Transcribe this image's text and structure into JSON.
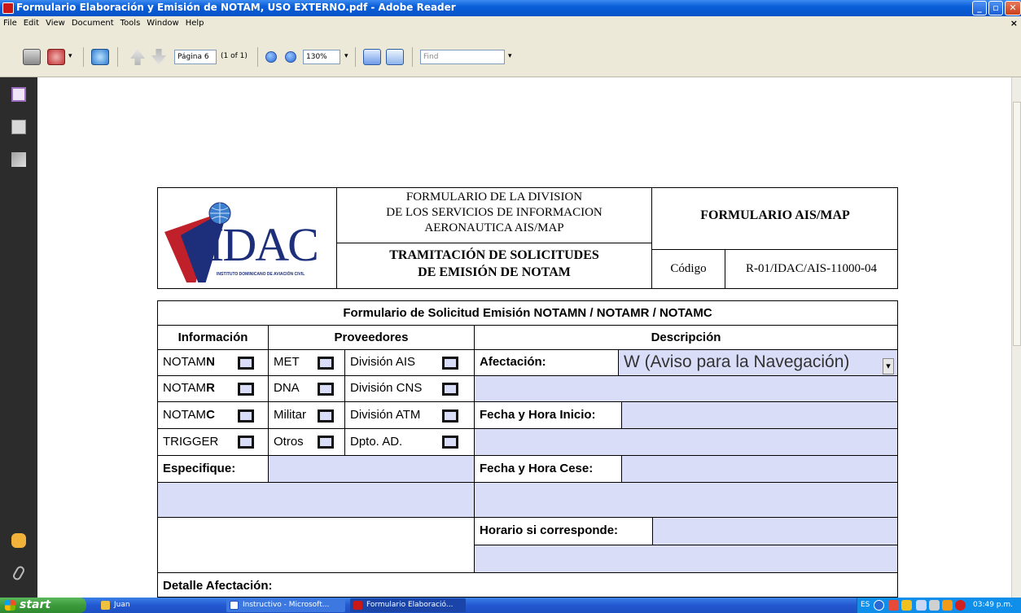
{
  "window": {
    "title": "Formulario Elaboración y Emisión de NOTAM, USO EXTERNO.pdf - Adobe Reader",
    "min": "_",
    "max": "▫",
    "close": "✕"
  },
  "menu": {
    "items": [
      "File",
      "Edit",
      "View",
      "Document",
      "Tools",
      "Window",
      "Help"
    ],
    "close": "×"
  },
  "toolbar": {
    "page_value": "Página 6",
    "page_count": "(1 of 1)",
    "zoom_value": "130%",
    "find_placeholder": "Find",
    "dropdown_glyph": "▾"
  },
  "header": {
    "logo_text": "IDAC",
    "logo_caption": "INSTITUTO DOMINICANO DE AVIACIÓN CIVIL",
    "title_line1": "FORMULARIO DE LA DIVISION",
    "title_line2": "DE LOS SERVICIOS DE INFORMACION",
    "title_line3": "AERONAUTICA AIS/MAP",
    "form_name": "FORMULARIO AIS/MAP",
    "subtitle_line1": "TRAMITACIÓN DE SOLICITUDES",
    "subtitle_line2": "DE EMISIÓN DE NOTAM",
    "code_label": "Código",
    "code_value": "R-01/IDAC/AIS-11000-04"
  },
  "form": {
    "title": "Formulario de Solicitud Emisión NOTAMN / NOTAMR / NOTAMC",
    "col_info": "Información",
    "col_providers": "Proveedores",
    "col_description": "Descripción",
    "notam_prefix": "NOTAM",
    "notam_n": "N",
    "notam_r": "R",
    "notam_c": "C",
    "trigger": "TRIGGER",
    "met": "MET",
    "dna": "DNA",
    "militar": "Militar",
    "otros": "Otros",
    "div_ais": "División AIS",
    "div_cns": "División CNS",
    "div_atm": "División ATM",
    "dpto_ad": "Dpto. AD.",
    "afectacion_label": "Afectación:",
    "afectacion_value": "W (Aviso para la Navegación)",
    "fecha_inicio_label": "Fecha y Hora Inicio:",
    "especifique_label": "Especifique:",
    "fecha_cese_label": "Fecha y Hora Cese:",
    "horario_label": "Horario si corresponde:",
    "detalle_label": "Detalle Afectación:"
  },
  "taskbar": {
    "start": "start",
    "tasks": [
      "Juan",
      "Instructivo - Microsoft...",
      "Formulario Elaboració..."
    ],
    "tray_lang": "ES",
    "clock": "03:49 p.m."
  },
  "colors": {
    "field_fill": "#d9ddf8",
    "title_bar": "#0a5fd8",
    "taskbar": "#2458d0",
    "start_green": "#3c9a3c",
    "logo_red": "#c0202a",
    "logo_blue": "#1d2f7a"
  }
}
